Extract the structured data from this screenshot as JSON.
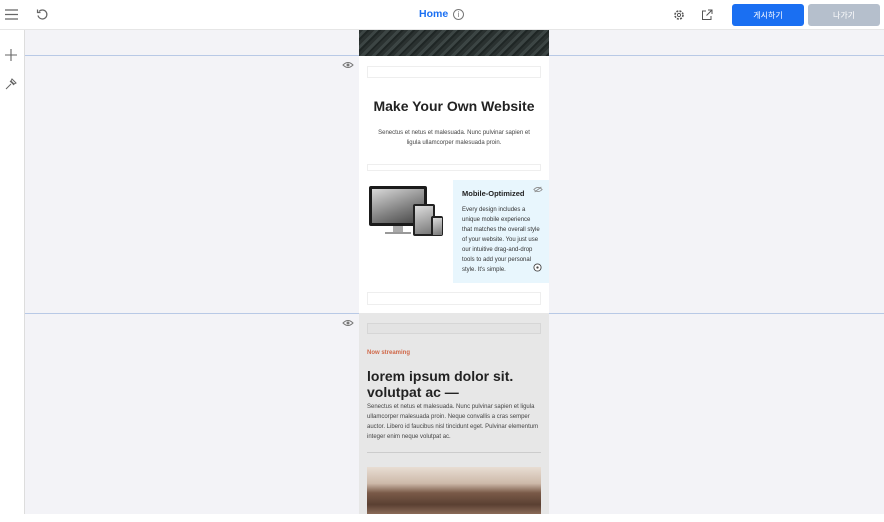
{
  "topbar": {
    "title": "Home",
    "info_glyph": "i",
    "publish_label": "게시하기",
    "exit_label": "나가기",
    "icons": [
      "menu-icon",
      "undo-icon",
      "info-icon",
      "settings-icon",
      "external-link-icon"
    ]
  },
  "sidebar": {
    "icons": [
      "add-icon",
      "design-tools-icon"
    ]
  },
  "page": {
    "hero_title": "Make Your Own Website",
    "hero_subtitle": "Senectus et netus et malesuada. Nunc pulvinar sapien et ligula ullamcorper malesuada proin.",
    "feature_title": "Mobile-Optimized",
    "feature_body": "Every design includes a unique mobile experience that matches the overall style of your website. You just use our intuitive drag-and-drop tools to add your personal style. It's simple.",
    "kicker": "Now streaming",
    "section_title": "lorem ipsum dolor sit. volutpat ac —",
    "section_body": "Senectus et netus et malesuada. Nunc pulvinar sapien et ligula ullamcorper malesuada proin. Neque convallis a cras semper auctor. Libero id faucibus nisl tincidunt eget. Pulvinar elementum integer enim neque volutpat ac."
  },
  "colors": {
    "accent": "#1a6ff2",
    "exit_button": "#b5bfcc",
    "kicker": "#d0694a",
    "feature_bg": "#e8f6fd"
  }
}
